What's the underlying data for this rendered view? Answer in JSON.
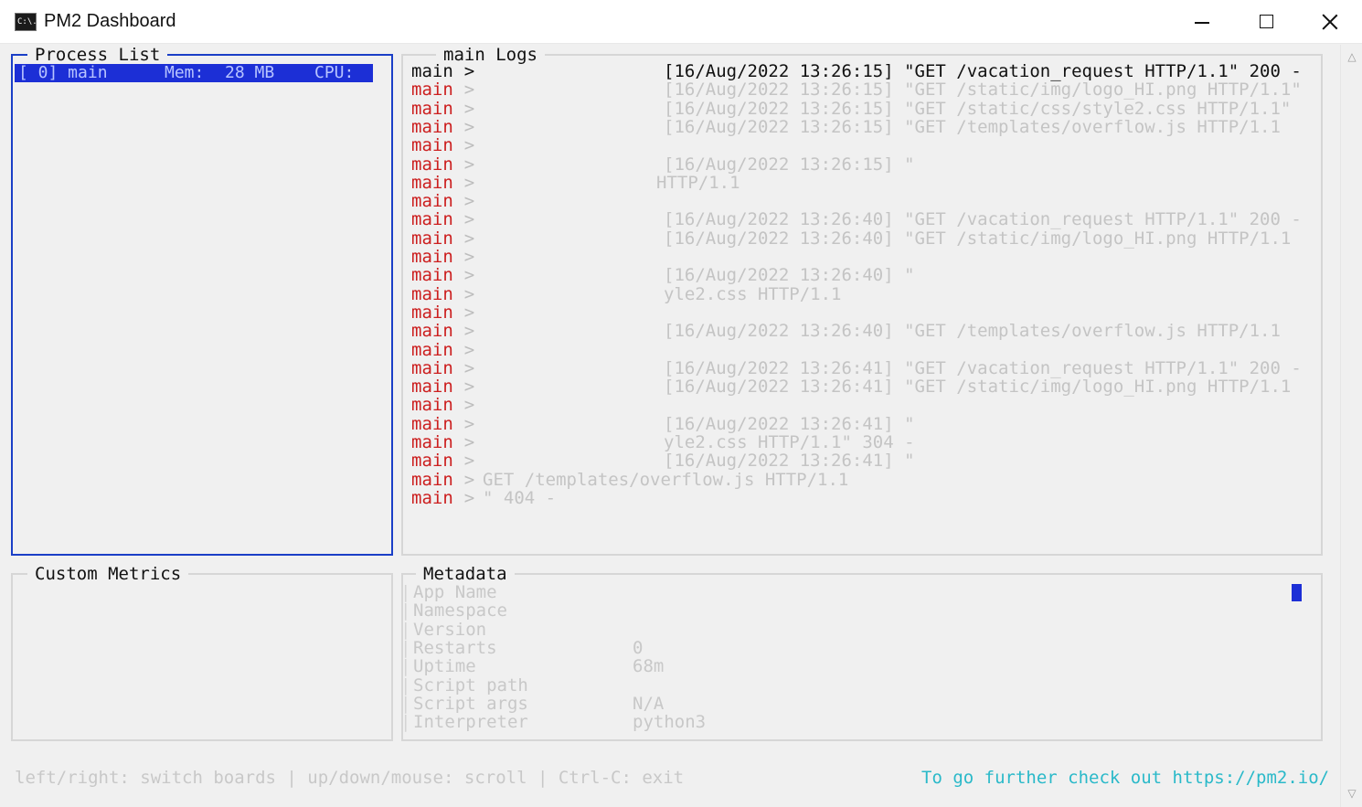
{
  "window": {
    "title": "PM2 Dashboard",
    "icon": "console-icon",
    "icon_text": "C:\\."
  },
  "process_list": {
    "title": "Process List",
    "rows": [
      {
        "id": "[ 0] main",
        "mem_label": "Mem:",
        "mem_value": "28 MB",
        "cpu_label": "CPU:"
      }
    ]
  },
  "logs": {
    "title": "main Logs",
    "lines": [
      {
        "src": "main",
        "arrow": ">",
        "msg": "[16/Aug/2022 13:26:15] \"GET /vacation_request HTTP/1.1\" 200 -",
        "indent": 726
      },
      {
        "src": "main",
        "arrow": ">",
        "msg": "[16/Aug/2022 13:26:15] \"GET /static/img/logo_HI.png HTTP/1.1\"",
        "indent": 726
      },
      {
        "src": "main",
        "arrow": ">",
        "msg": "[16/Aug/2022 13:26:15] \"GET /static/css/style2.css HTTP/1.1\"",
        "indent": 726
      },
      {
        "src": "main",
        "arrow": ">",
        "msg": "[16/Aug/2022 13:26:15] \"GET /templates/overflow.js HTTP/1.1",
        "indent": 726
      },
      {
        "src": "main",
        "arrow": ">",
        "msg": "",
        "indent": 726
      },
      {
        "src": "main",
        "arrow": ">",
        "msg": "[16/Aug/2022 13:26:15] \"",
        "indent": 726
      },
      {
        "src": "main",
        "arrow": ">",
        "msg": "HTTP/1.1",
        "indent": 718
      },
      {
        "src": "main",
        "arrow": ">",
        "msg": "",
        "indent": 726
      },
      {
        "src": "main",
        "arrow": ">",
        "msg": "[16/Aug/2022 13:26:40] \"GET /vacation_request HTTP/1.1\" 200 -",
        "indent": 726
      },
      {
        "src": "main",
        "arrow": ">",
        "msg": "[16/Aug/2022 13:26:40] \"GET /static/img/logo_HI.png HTTP/1.1",
        "indent": 726
      },
      {
        "src": "main",
        "arrow": ">",
        "msg": "",
        "indent": 726
      },
      {
        "src": "main",
        "arrow": ">",
        "msg": "[16/Aug/2022 13:26:40] \"",
        "indent": 726
      },
      {
        "src": "main",
        "arrow": ">",
        "msg": "yle2.css HTTP/1.1",
        "indent": 726
      },
      {
        "src": "main",
        "arrow": ">",
        "msg": "",
        "indent": 726
      },
      {
        "src": "main",
        "arrow": ">",
        "msg": "[16/Aug/2022 13:26:40] \"GET /templates/overflow.js HTTP/1.1",
        "indent": 726
      },
      {
        "src": "main",
        "arrow": ">",
        "msg": "",
        "indent": 726
      },
      {
        "src": "main",
        "arrow": ">",
        "msg": "[16/Aug/2022 13:26:41] \"GET /vacation_request HTTP/1.1\" 200 -",
        "indent": 726
      },
      {
        "src": "main",
        "arrow": ">",
        "msg": "[16/Aug/2022 13:26:41] \"GET /static/img/logo_HI.png HTTP/1.1",
        "indent": 726
      },
      {
        "src": "main",
        "arrow": ">",
        "msg": "",
        "indent": 726
      },
      {
        "src": "main",
        "arrow": ">",
        "msg": "[16/Aug/2022 13:26:41] \"",
        "indent": 726
      },
      {
        "src": "main",
        "arrow": ">",
        "msg": "yle2.css HTTP/1.1\" 304 -",
        "indent": 726
      },
      {
        "src": "main",
        "arrow": ">",
        "msg": "[16/Aug/2022 13:26:41] \"",
        "indent": 726
      },
      {
        "src": "main",
        "arrow": ">",
        "msg": "GET /templates/overflow.js HTTP/1.1",
        "indent": 528
      },
      {
        "src": "main",
        "arrow": ">",
        "msg": "\" 404 -",
        "indent": 528
      }
    ]
  },
  "custom_metrics": {
    "title": "Custom Metrics"
  },
  "metadata": {
    "title": "Metadata",
    "rows": [
      {
        "label": "App Name",
        "value": ""
      },
      {
        "label": "Namespace",
        "value": ""
      },
      {
        "label": "Version",
        "value": ""
      },
      {
        "label": "Restarts",
        "value": "0"
      },
      {
        "label": "Uptime",
        "value": "68m"
      },
      {
        "label": "Script path",
        "value": ""
      },
      {
        "label": "Script args",
        "value": "N/A"
      },
      {
        "label": "Interpreter",
        "value": "python3"
      }
    ]
  },
  "footer": {
    "help": "left/right: switch boards | up/down/mouse: scroll | Ctrl-C: exit",
    "link": "To go further check out https://pm2.io/"
  },
  "colors": {
    "active_border": "#1a3fc7",
    "selection_bg": "#1c2fd6",
    "log_source": "#cc1f1f",
    "link": "#2ab9c9"
  }
}
